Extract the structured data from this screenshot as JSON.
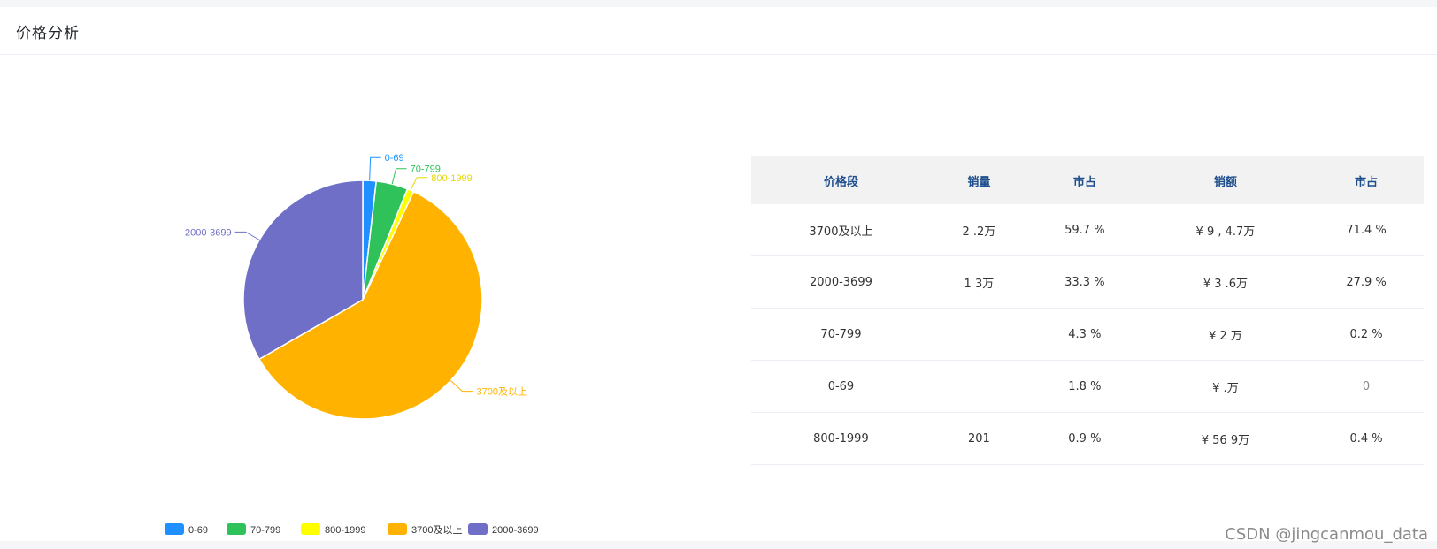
{
  "header": {
    "title": "价格分析"
  },
  "chart_data": {
    "type": "pie",
    "series_labels": [
      "0-69",
      "70-799",
      "800-1999",
      "3700及以上",
      "2000-3699"
    ],
    "values": [
      1.8,
      4.3,
      0.9,
      59.7,
      33.3
    ],
    "colors": [
      "#1e90ff",
      "#2fc25b",
      "#ffff00",
      "#ffb300",
      "#6f6fc8"
    ],
    "legend_position": "bottom-center",
    "legend": [
      "0-69",
      "70-799",
      "800-1999",
      "3700及以上",
      "2000-3699"
    ]
  },
  "table": {
    "columns": [
      "价格段",
      "销量",
      "市占",
      "销额",
      "市占"
    ],
    "rows": [
      [
        "3700及以上",
        "2 .2万",
        "59.7 %",
        "¥ 9 , 4.7万",
        "71.4 %"
      ],
      [
        "2000-3699",
        "1 3万",
        "33.3 %",
        "¥ 3 .6万",
        "27.9 %"
      ],
      [
        "70-799",
        "",
        "4.3 %",
        "¥ 2 万",
        "0.2 %"
      ],
      [
        "0-69",
        "",
        "1.8 %",
        "¥ .万",
        "0"
      ],
      [
        "800-1999",
        "201",
        "0.9 %",
        "¥ 56 9万",
        "0.4 %"
      ]
    ]
  },
  "watermark": "CSDN @jingcanmou_data"
}
